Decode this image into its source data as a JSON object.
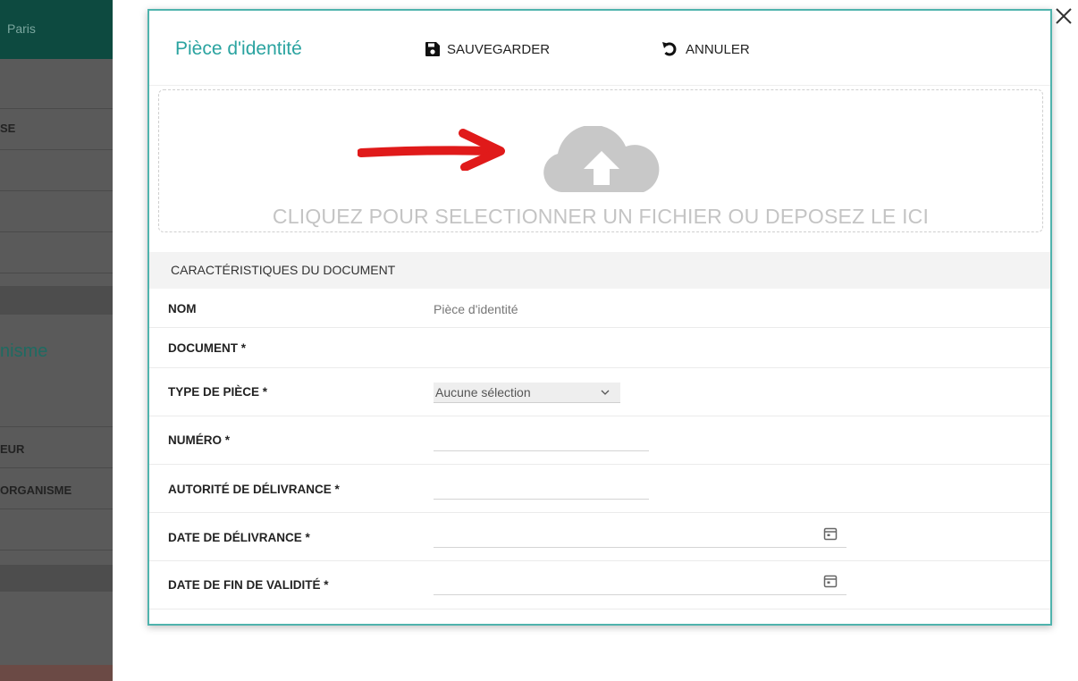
{
  "background_page": {
    "header_text": "Paris",
    "row_fragments": [
      "SE",
      "EUR",
      "ORGANISME"
    ],
    "section_title_fragment": "nisme"
  },
  "close": {
    "icon": "close-icon"
  },
  "modal": {
    "title": "Pièce d'identité",
    "save_label": "SAUVEGARDER",
    "cancel_label": "ANNULER",
    "dropzone_text": "CLIQUEZ POUR SELECTIONNER UN FICHIER OU DEPOSEZ LE ICI",
    "section_title": "CARACTÉRISTIQUES DU DOCUMENT",
    "fields": {
      "nom": {
        "label": "NOM",
        "value": "Pièce d'identité"
      },
      "document": {
        "label": "DOCUMENT *"
      },
      "type_piece": {
        "label": "TYPE DE PIÈCE *",
        "selected": "Aucune sélection"
      },
      "numero": {
        "label": "NUMÉRO *",
        "value": ""
      },
      "autorite": {
        "label": "AUTORITÉ DE DÉLIVRANCE *",
        "value": ""
      },
      "date_delivrance": {
        "label": "DATE DE DÉLIVRANCE *",
        "value": ""
      },
      "date_fin": {
        "label": "DATE DE FIN DE VALIDITÉ *",
        "value": ""
      }
    }
  },
  "colors": {
    "accent": "#2aa3a0",
    "modal_border": "#4fb3ad",
    "annotation_arrow": "#e01a1a",
    "cloud": "#c8c8c8"
  }
}
